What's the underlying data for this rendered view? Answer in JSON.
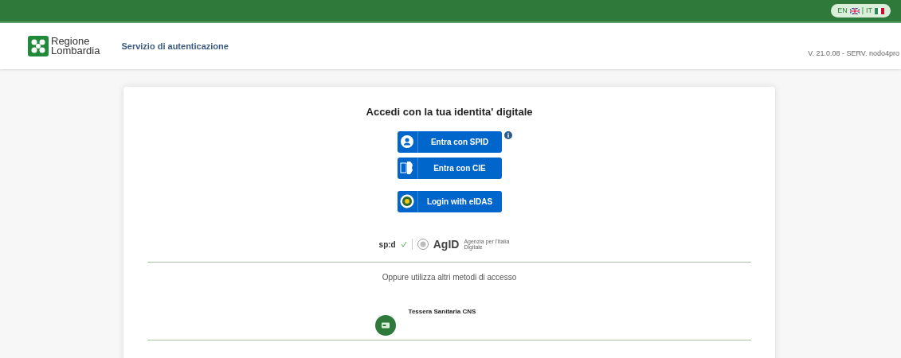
{
  "top_bar": {
    "languages": [
      {
        "code": "EN",
        "kind": "uk"
      },
      {
        "code": "IT",
        "kind": "it"
      }
    ],
    "separator": "|"
  },
  "header": {
    "logo_line1": "Regione",
    "logo_line2": "Lombardia",
    "service": "Servizio di autenticazione",
    "version": "V. 21.0.08 - SERV. nodo4pro"
  },
  "card": {
    "title": "Accedi con la tua identita' digitale",
    "buttons": [
      {
        "label": "Entra con SPID",
        "kind": "spid",
        "info": true
      },
      {
        "label": "Entra con CIE",
        "kind": "cie",
        "info": false
      },
      {
        "label": "Login with eIDAS",
        "kind": "eidas",
        "info": false
      }
    ],
    "logos": {
      "spid": "sp:d",
      "agid": "AgID",
      "agid_sub": "Agenzia per l'Italia Digitale"
    },
    "other_methods": "Oppure utilizza altri metodi di accesso",
    "methods": [
      {
        "label": "Tessera Sanitaria CNS"
      }
    ]
  }
}
